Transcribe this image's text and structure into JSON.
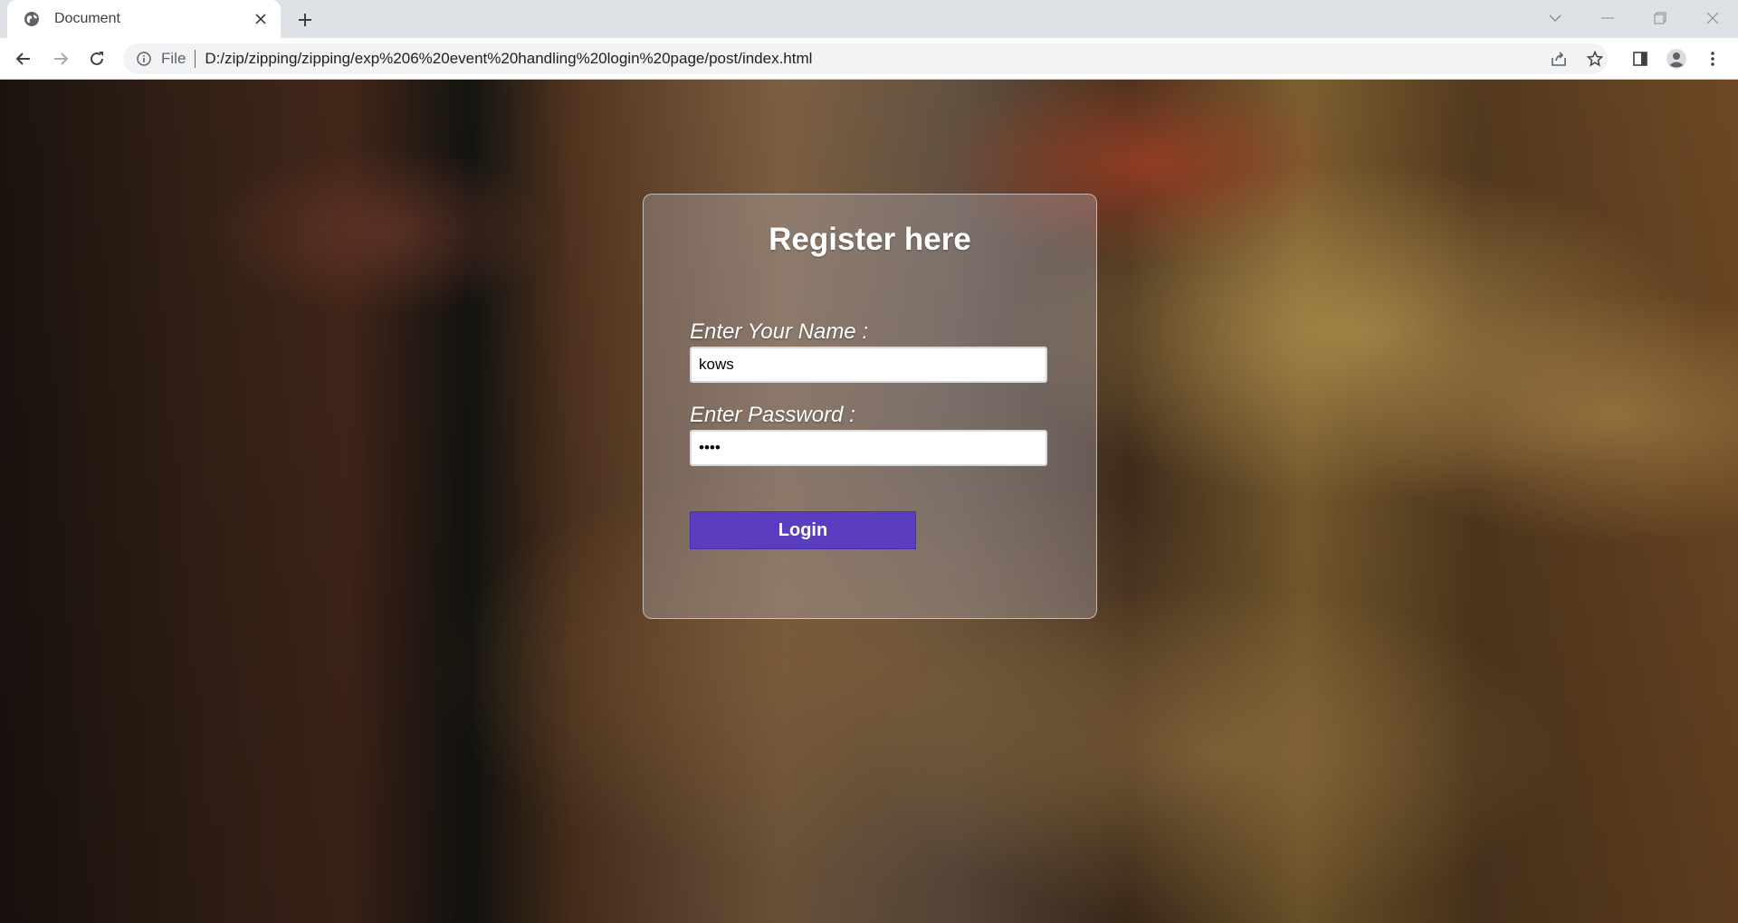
{
  "browser": {
    "tab": {
      "title": "Document",
      "favicon": "globe-icon"
    },
    "address": {
      "scheme_label": "File",
      "url": "D:/zip/zipping/zipping/exp%206%20event%20handling%20login%20page/post/index.html"
    },
    "icons": {
      "back": "back-arrow-icon",
      "forward": "forward-arrow-icon",
      "reload": "reload-icon",
      "share": "share-icon",
      "bookmark": "star-icon",
      "side_panel": "side-panel-icon",
      "profile": "profile-icon",
      "menu": "kebab-menu-icon"
    }
  },
  "form": {
    "heading": "Register here",
    "name_label": "Enter Your Name :",
    "name_value": "kows",
    "password_label": "Enter Password :",
    "password_value": "kows",
    "submit_label": "Login"
  },
  "colors": {
    "button": "#5b3ec0",
    "chrome_bg": "#dee1e6"
  }
}
